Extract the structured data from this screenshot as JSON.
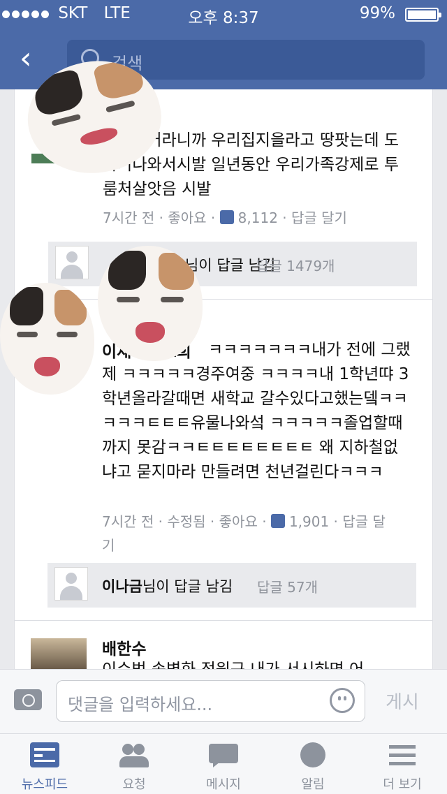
{
  "status_bar": {
    "carrier": "SKT",
    "network": "LTE",
    "time": "오후 8:37",
    "battery": "99%"
  },
  "header": {
    "search_placeholder": "검색"
  },
  "comments": [
    {
      "name_fragment": "가",
      "text": "시발이거라니까 우리집지을라고 땅팟는데 도자기나와서시발 일년동안 우리가족강제로 투룸처살앗음 시발",
      "time": "7시간 전",
      "like": "좋아요",
      "likes": "8,112",
      "reply": "답글 달기",
      "reply_summary": "님이 답글 남김",
      "reply_count": "답글 1479개"
    },
    {
      "name": "이재",
      "name2": "김도희",
      "text": "ㅋㅋㅋㅋㅋㅋㅋ내가 전에 그랬제 ㅋㅋㅋㅋㅋ경주여중 ㅋㅋㅋㅋ내 1학년땨 3학년올라갈때면 새학교 갈수있다고했는뎈ㅋㅋㅋㅋㅋㅌㅌㅌ유물나와섴 ㅋㅋㅋㅋㅋ졸업할때까지 못감ㅋㅋㅌㅌㅌㅌㅌㅌㅌㅌ 왜 지하철없냐고 묻지마라 만들려면 천년걸린다ㅋㅋㅋ",
      "time": "7시간 전",
      "edited": "수정됨",
      "like": "좋아요",
      "likes": "1,901",
      "reply": "답글 달기",
      "reply_name": "이나금",
      "reply_summary": "님이 답글 남김",
      "reply_count": "답글 57개"
    },
    {
      "name": "배한수",
      "text_partial": "이수범 송병화 정원구 내가 서시하면 어"
    }
  ],
  "composer": {
    "placeholder": "댓글을 입력하세요...",
    "post_label": "게시"
  },
  "tabs": [
    {
      "label": "뉴스피드",
      "icon": "news-feed-icon",
      "active": true
    },
    {
      "label": "요청",
      "icon": "friend-requests-icon",
      "active": false
    },
    {
      "label": "메시지",
      "icon": "messages-icon",
      "active": false
    },
    {
      "label": "알림",
      "icon": "globe-icon",
      "active": false
    },
    {
      "label": "더 보기",
      "icon": "menu-icon",
      "active": false
    }
  ],
  "colors": {
    "header": "#4b6aa8",
    "active_tab": "#4b6aa8",
    "inactive": "#8d939d"
  }
}
